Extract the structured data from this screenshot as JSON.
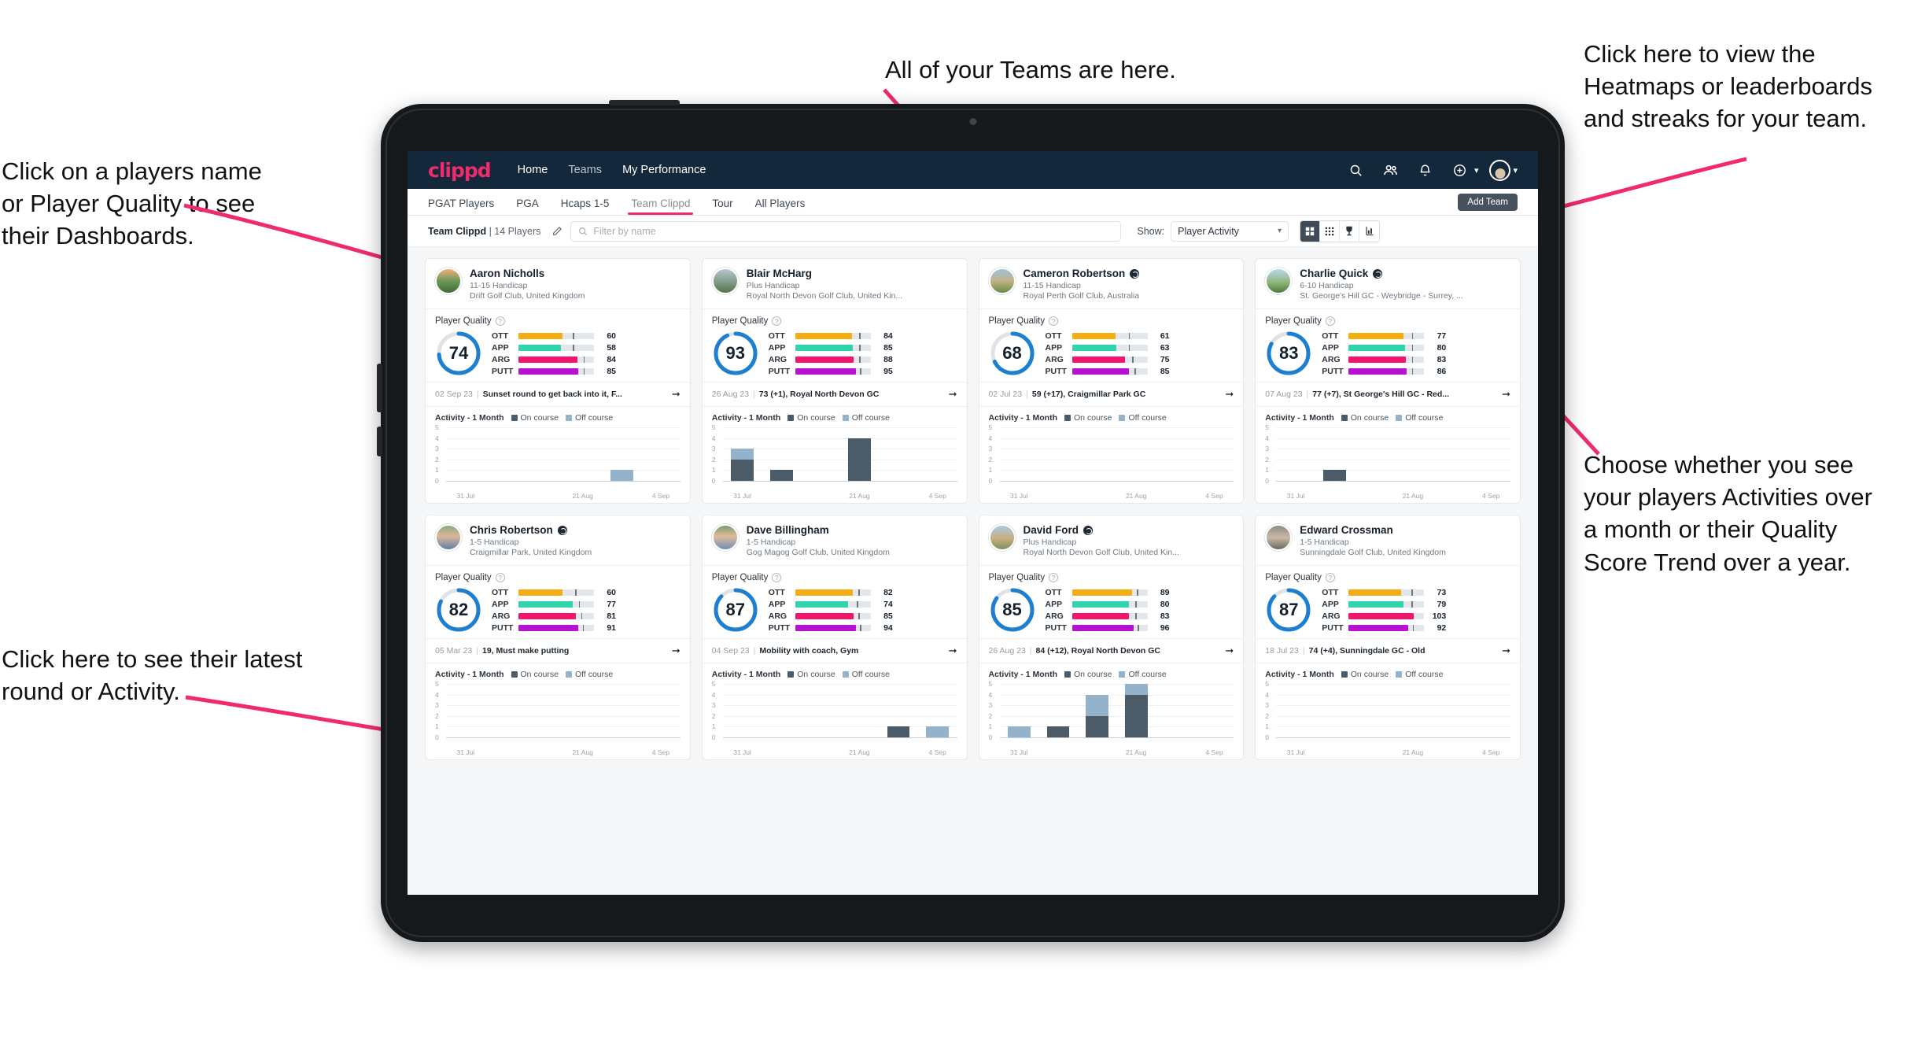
{
  "annotations": [
    {
      "id": "players-name",
      "text": "Click on a players name\nor Player Quality to see\ntheir Dashboards."
    },
    {
      "id": "teams-here",
      "text": "All of your Teams are here."
    },
    {
      "id": "heatmaps",
      "text": "Click here to view the\nHeatmaps or leaderboards\nand streaks for your team."
    },
    {
      "id": "activity-choice",
      "text": "Choose whether you see\nyour players Activities over\na month or their Quality\nScore Trend over a year."
    },
    {
      "id": "latest-round",
      "text": "Click here to see their latest\nround or Activity."
    }
  ],
  "topnav": {
    "logo": "clippd",
    "links": [
      {
        "label": "Home",
        "active": true
      },
      {
        "label": "Teams",
        "active": false
      },
      {
        "label": "My Performance",
        "active": true
      }
    ],
    "icons": [
      "search-icon",
      "people-icon",
      "bell-icon",
      "plus-circle-icon"
    ]
  },
  "tabs": [
    {
      "label": "PGAT Players",
      "active": false
    },
    {
      "label": "PGA",
      "active": false
    },
    {
      "label": "Hcaps 1-5",
      "active": false
    },
    {
      "label": "Team Clippd",
      "active": true
    },
    {
      "label": "Tour",
      "active": false
    },
    {
      "label": "All Players",
      "active": false
    }
  ],
  "add_team_label": "Add Team",
  "toolbar": {
    "team_name": "Team Clippd",
    "team_count": "| 14 Players",
    "search_placeholder": "Filter by name",
    "show_label": "Show:",
    "show_value": "Player Activity",
    "view_buttons": [
      "grid-large-icon",
      "grid-small-icon",
      "trophy-icon",
      "heatmap-icon"
    ]
  },
  "card_labels": {
    "quality_title": "Player Quality",
    "activity_title": "Activity - 1 Month",
    "legend_on": "On course",
    "legend_off": "Off course"
  },
  "colors": {
    "accent": "#ef2b6b",
    "navy": "#14283c",
    "ring": "#1d7fd0",
    "ott": "#f5ae12",
    "app": "#2fd3ac",
    "arg": "#f5156c",
    "putt": "#b812d1",
    "on_course": "#4c5b68",
    "off_course": "#93b2cc"
  },
  "chart_data": {
    "type": "bar",
    "title": "Activity - 1 Month",
    "ylabel": "",
    "ylim": [
      0,
      5
    ],
    "yticks": [
      0,
      1,
      2,
      3,
      4,
      5
    ],
    "xlabel": "",
    "categories": [
      "31 Jul",
      "",
      "",
      "21 Aug",
      "",
      "4 Sep"
    ],
    "legend": [
      "On course",
      "Off course"
    ],
    "legend_position": "top",
    "grid": true,
    "stacked": true,
    "panels": [
      {
        "player": "Aaron Nicholls",
        "on_course": [
          0,
          0,
          0,
          0,
          1,
          0
        ],
        "off_course": [
          0,
          0,
          0,
          0,
          0,
          0
        ],
        "off_only": [
          0,
          0,
          0,
          0,
          1,
          0
        ]
      },
      {
        "player": "Blair McHarg",
        "on_course": [
          2,
          1,
          0,
          4,
          0,
          0
        ],
        "off_course": [
          1,
          0,
          0,
          0,
          0,
          0
        ]
      },
      {
        "player": "Cameron Robertson",
        "on_course": [
          0,
          0,
          0,
          0,
          0,
          0
        ],
        "off_course": [
          0,
          0,
          0,
          0,
          0,
          0
        ]
      },
      {
        "player": "Charlie Quick",
        "on_course": [
          0,
          1,
          0,
          0,
          0,
          0
        ],
        "off_course": [
          0,
          0,
          0,
          0,
          0,
          0
        ]
      },
      {
        "player": "Chris Robertson",
        "on_course": [
          0,
          0,
          0,
          0,
          0,
          0
        ],
        "off_course": [
          0,
          0,
          0,
          0,
          0,
          0
        ]
      },
      {
        "player": "Dave Billingham",
        "on_course": [
          0,
          0,
          0,
          0,
          1,
          0
        ],
        "off_course": [
          0,
          0,
          0,
          0,
          0,
          1
        ]
      },
      {
        "player": "David Ford",
        "on_course": [
          0,
          1,
          2,
          4,
          0,
          0
        ],
        "off_course": [
          1,
          0,
          2,
          1,
          0,
          0
        ]
      },
      {
        "player": "Edward Crossman",
        "on_course": [
          0,
          0,
          0,
          0,
          0,
          0
        ],
        "off_course": [
          0,
          0,
          0,
          0,
          0,
          0
        ]
      }
    ]
  },
  "players": [
    {
      "name": "Aaron Nicholls",
      "verified": false,
      "handicap": "11-15 Handicap",
      "club": "Drift Golf Club, United Kingdom",
      "quality": 74,
      "metrics": [
        {
          "label": "OTT",
          "value": 60,
          "color": "#f5ae12",
          "fill": 58,
          "tick": 72
        },
        {
          "label": "APP",
          "value": 58,
          "color": "#2fd3ac",
          "fill": 56,
          "tick": 72
        },
        {
          "label": "ARG",
          "value": 84,
          "color": "#f5156c",
          "fill": 78,
          "tick": 86
        },
        {
          "label": "PUTT",
          "value": 85,
          "color": "#b812d1",
          "fill": 79,
          "tick": 86
        }
      ],
      "round_date": "02 Sep 23",
      "round_text": "Sunset round to get back into it, F...",
      "activity": {
        "on_course": [
          0,
          0,
          0,
          0,
          0,
          0
        ],
        "off_course": [
          0,
          0,
          0,
          0,
          1,
          0
        ]
      }
    },
    {
      "name": "Blair McHarg",
      "verified": false,
      "handicap": "Plus Handicap",
      "club": "Royal North Devon Golf Club, United Kin...",
      "quality": 93,
      "metrics": [
        {
          "label": "OTT",
          "value": 84,
          "color": "#f5ae12",
          "fill": 75,
          "tick": 85
        },
        {
          "label": "APP",
          "value": 85,
          "color": "#2fd3ac",
          "fill": 76,
          "tick": 85
        },
        {
          "label": "ARG",
          "value": 88,
          "color": "#f5156c",
          "fill": 77,
          "tick": 85
        },
        {
          "label": "PUTT",
          "value": 95,
          "color": "#b812d1",
          "fill": 80,
          "tick": 86
        }
      ],
      "round_date": "26 Aug 23",
      "round_text": "73 (+1), Royal North Devon GC",
      "activity": {
        "on_course": [
          2,
          1,
          0,
          4,
          0,
          0
        ],
        "off_course": [
          1,
          0,
          0,
          0,
          0,
          0
        ]
      }
    },
    {
      "name": "Cameron Robertson",
      "verified": true,
      "handicap": "11-15 Handicap",
      "club": "Royal Perth Golf Club, Australia",
      "quality": 68,
      "metrics": [
        {
          "label": "OTT",
          "value": 61,
          "color": "#f5ae12",
          "fill": 58,
          "tick": 75
        },
        {
          "label": "APP",
          "value": 63,
          "color": "#2fd3ac",
          "fill": 59,
          "tick": 75
        },
        {
          "label": "ARG",
          "value": 75,
          "color": "#f5156c",
          "fill": 70,
          "tick": 80
        },
        {
          "label": "PUTT",
          "value": 85,
          "color": "#b812d1",
          "fill": 76,
          "tick": 83
        }
      ],
      "round_date": "02 Jul 23",
      "round_text": "59 (+17), Craigmillar Park GC",
      "activity": {
        "on_course": [
          0,
          0,
          0,
          0,
          0,
          0
        ],
        "off_course": [
          0,
          0,
          0,
          0,
          0,
          0
        ]
      }
    },
    {
      "name": "Charlie Quick",
      "verified": true,
      "handicap": "6-10 Handicap",
      "club": "St. George's Hill GC - Weybridge - Surrey, ...",
      "quality": 83,
      "metrics": [
        {
          "label": "OTT",
          "value": 77,
          "color": "#f5ae12",
          "fill": 73,
          "tick": 84
        },
        {
          "label": "APP",
          "value": 80,
          "color": "#2fd3ac",
          "fill": 75,
          "tick": 84
        },
        {
          "label": "ARG",
          "value": 83,
          "color": "#f5156c",
          "fill": 76,
          "tick": 84
        },
        {
          "label": "PUTT",
          "value": 86,
          "color": "#b812d1",
          "fill": 77,
          "tick": 84
        }
      ],
      "round_date": "07 Aug 23",
      "round_text": "77 (+7), St George's Hill GC - Red...",
      "activity": {
        "on_course": [
          0,
          1,
          0,
          0,
          0,
          0
        ],
        "off_course": [
          0,
          0,
          0,
          0,
          0,
          0
        ]
      }
    },
    {
      "name": "Chris Robertson",
      "verified": true,
      "handicap": "1-5 Handicap",
      "club": "Craigmillar Park, United Kingdom",
      "quality": 82,
      "metrics": [
        {
          "label": "OTT",
          "value": 60,
          "color": "#f5ae12",
          "fill": 58,
          "tick": 75
        },
        {
          "label": "APP",
          "value": 77,
          "color": "#2fd3ac",
          "fill": 72,
          "tick": 80
        },
        {
          "label": "ARG",
          "value": 81,
          "color": "#f5156c",
          "fill": 76,
          "tick": 83
        },
        {
          "label": "PUTT",
          "value": 91,
          "color": "#b812d1",
          "fill": 79,
          "tick": 85
        }
      ],
      "round_date": "05 Mar 23",
      "round_text": "19, Must make putting",
      "activity": {
        "on_course": [
          0,
          0,
          0,
          0,
          0,
          0
        ],
        "off_course": [
          0,
          0,
          0,
          0,
          0,
          0
        ]
      }
    },
    {
      "name": "Dave Billingham",
      "verified": false,
      "handicap": "1-5 Handicap",
      "club": "Gog Magog Golf Club, United Kingdom",
      "quality": 87,
      "metrics": [
        {
          "label": "OTT",
          "value": 82,
          "color": "#f5ae12",
          "fill": 76,
          "tick": 84
        },
        {
          "label": "APP",
          "value": 74,
          "color": "#2fd3ac",
          "fill": 70,
          "tick": 82
        },
        {
          "label": "ARG",
          "value": 85,
          "color": "#f5156c",
          "fill": 77,
          "tick": 84
        },
        {
          "label": "PUTT",
          "value": 94,
          "color": "#b812d1",
          "fill": 80,
          "tick": 86
        }
      ],
      "round_date": "04 Sep 23",
      "round_text": "Mobility with coach, Gym",
      "activity": {
        "on_course": [
          0,
          0,
          0,
          0,
          1,
          0
        ],
        "off_course": [
          0,
          0,
          0,
          0,
          0,
          1
        ]
      }
    },
    {
      "name": "David Ford",
      "verified": true,
      "handicap": "Plus Handicap",
      "club": "Royal North Devon Golf Club, United Kin...",
      "quality": 85,
      "metrics": [
        {
          "label": "OTT",
          "value": 89,
          "color": "#f5ae12",
          "fill": 80,
          "tick": 86
        },
        {
          "label": "APP",
          "value": 80,
          "color": "#2fd3ac",
          "fill": 75,
          "tick": 84
        },
        {
          "label": "ARG",
          "value": 83,
          "color": "#f5156c",
          "fill": 76,
          "tick": 84
        },
        {
          "label": "PUTT",
          "value": 96,
          "color": "#b812d1",
          "fill": 82,
          "tick": 87
        }
      ],
      "round_date": "26 Aug 23",
      "round_text": "84 (+12), Royal North Devon GC",
      "activity": {
        "on_course": [
          0,
          1,
          2,
          4,
          0,
          0
        ],
        "off_course": [
          1,
          0,
          2,
          1,
          0,
          0
        ]
      }
    },
    {
      "name": "Edward Crossman",
      "verified": false,
      "handicap": "1-5 Handicap",
      "club": "Sunningdale Golf Club, United Kingdom",
      "quality": 87,
      "metrics": [
        {
          "label": "OTT",
          "value": 73,
          "color": "#f5ae12",
          "fill": 70,
          "tick": 83
        },
        {
          "label": "APP",
          "value": 79,
          "color": "#2fd3ac",
          "fill": 73,
          "tick": 83
        },
        {
          "label": "ARG",
          "value": 103,
          "color": "#f5156c",
          "fill": 86,
          "tick": 0
        },
        {
          "label": "PUTT",
          "value": 92,
          "color": "#b812d1",
          "fill": 79,
          "tick": 85
        }
      ],
      "round_date": "18 Jul 23",
      "round_text": "74 (+4), Sunningdale GC - Old",
      "activity": {
        "on_course": [
          0,
          0,
          0,
          0,
          0,
          0
        ],
        "off_course": [
          0,
          0,
          0,
          0,
          0,
          0
        ]
      }
    }
  ]
}
